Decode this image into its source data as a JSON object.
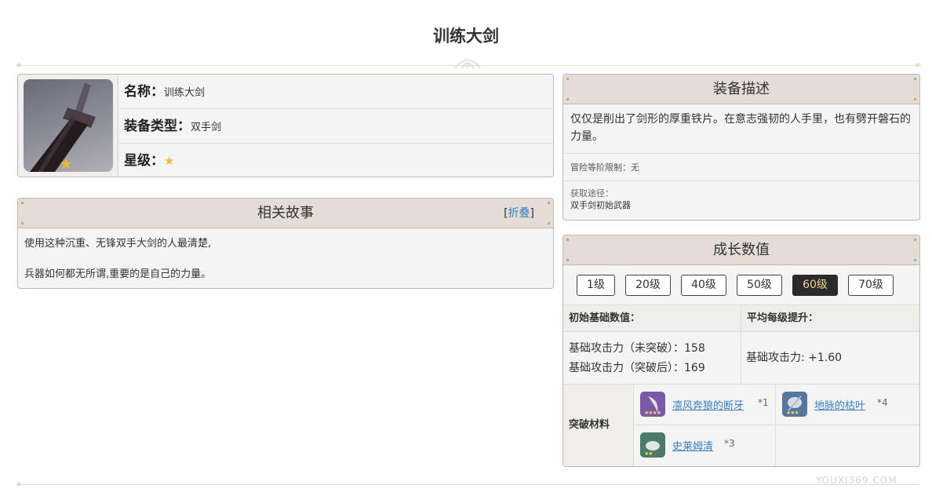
{
  "page": {
    "title": "训练大剑"
  },
  "info": {
    "name_key": "名称：",
    "name_value": "训练大剑",
    "type_key": "装备类型：",
    "type_value": "双手剑",
    "rarity_key": "星级：",
    "rarity_stars": 1
  },
  "story": {
    "title": "相关故事",
    "fold_open": "[",
    "fold_label": "折叠",
    "fold_close": "]",
    "paragraphs": [
      "使用这种沉重、无锋双手大剑的人最清楚,",
      "兵器如何都无所谓,重要的是自己的力量。"
    ]
  },
  "description": {
    "title": "装备描述",
    "text": "仅仅是削出了剑形的厚重铁片。在意志强韧的人手里，也有劈开磐石的力量。",
    "limit": "冒险等阶限制：无",
    "source_label": "获取途径：",
    "source_value": "双手剑初始武器"
  },
  "growth": {
    "title": "成长数值",
    "levels": [
      "1级",
      "20级",
      "40级",
      "50级",
      "60级",
      "70级"
    ],
    "selected_level": "60级",
    "base_header": "初始基础数值：",
    "per_level_header": "平均每级提升：",
    "base_before": "基础攻击力（未突破）：158",
    "base_after": "基础攻击力（突破后）：169",
    "per_level_value": "基础攻击力: +1.60",
    "materials_label": "突破材料",
    "materials": [
      {
        "name": "凛风奔狼的断牙",
        "count": "*1",
        "stars": 4,
        "color": "#7a5aa8"
      },
      {
        "name": "地脉的枯叶",
        "count": "*4",
        "stars": 3,
        "color": "#5676a0"
      },
      {
        "name": "史莱姆清",
        "count": "*3",
        "stars": 2,
        "color": "#4a7a6a"
      }
    ]
  },
  "watermark": {
    "site": "YOUXI369.COM"
  }
}
